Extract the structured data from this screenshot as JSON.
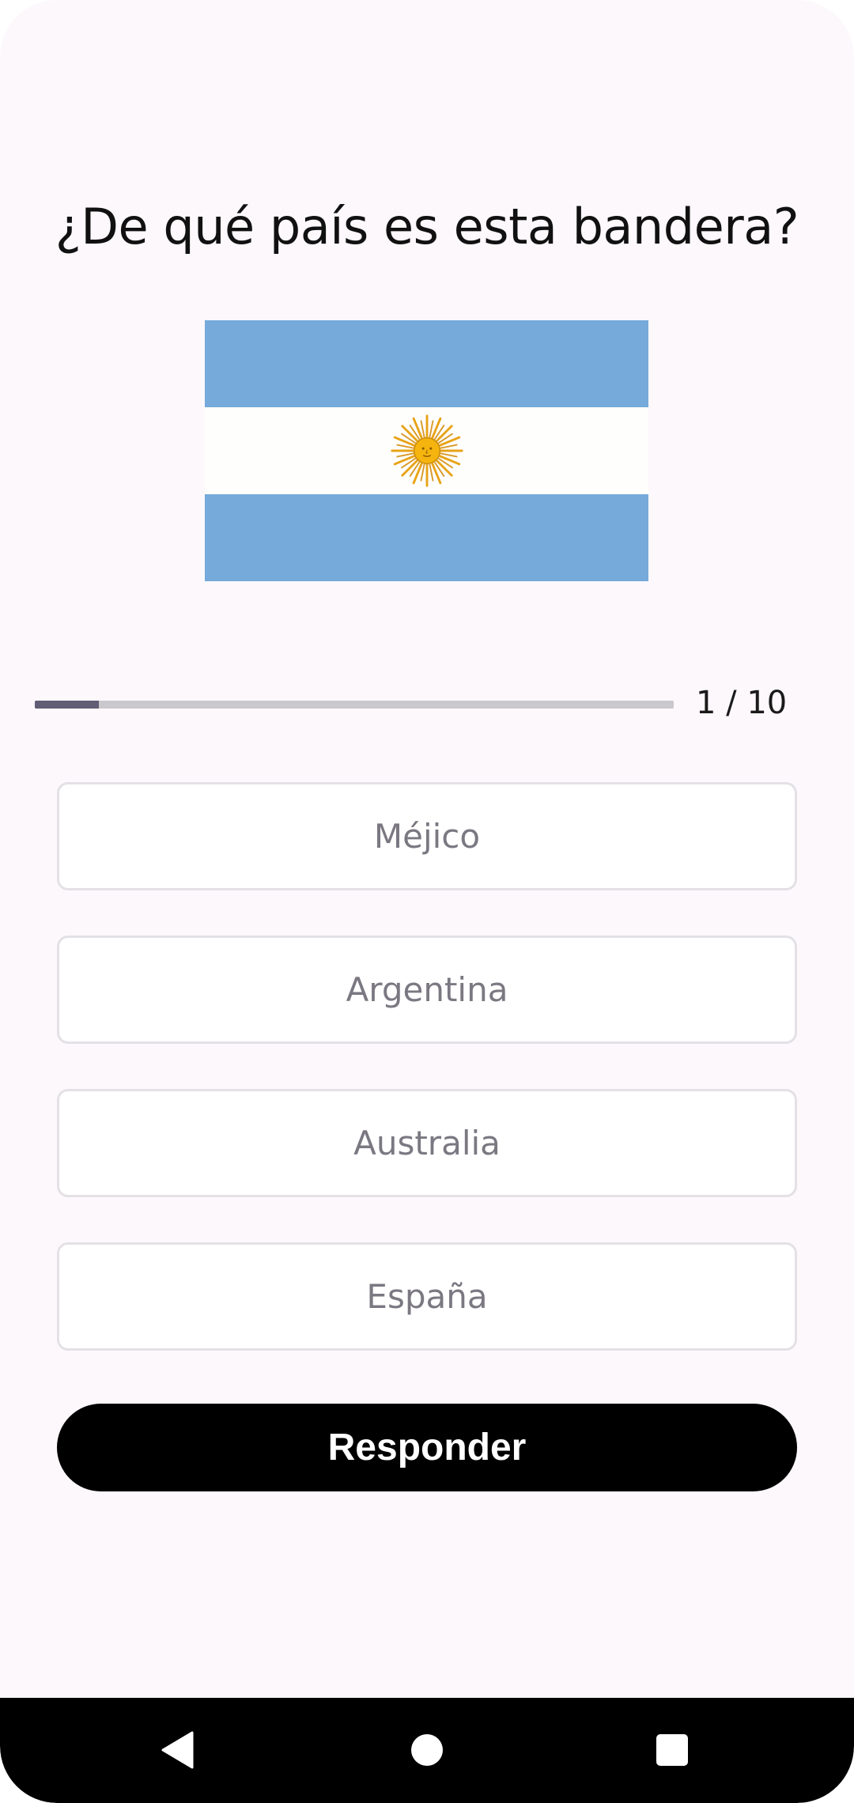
{
  "quiz": {
    "question": "¿De qué país es esta bandera?",
    "flag_icon": "argentina-flag",
    "progress": {
      "current": 1,
      "total": 10,
      "label": "1 / 10",
      "fraction": 0.1
    },
    "options": [
      {
        "label": "Méjico"
      },
      {
        "label": "Argentina"
      },
      {
        "label": "Australia"
      },
      {
        "label": "España"
      }
    ],
    "submit_label": "Responder"
  },
  "navigation_bar": {
    "back_icon": "triangle-back-icon",
    "home_icon": "circle-home-icon",
    "recents_icon": "square-recents-icon"
  },
  "colors": {
    "background": "#fdf8fb",
    "flag_blue": "#75aadb",
    "flag_sun": "#f6b40e",
    "progress_fill": "#615d74",
    "progress_track": "#cac7cd",
    "button": "#000000"
  }
}
